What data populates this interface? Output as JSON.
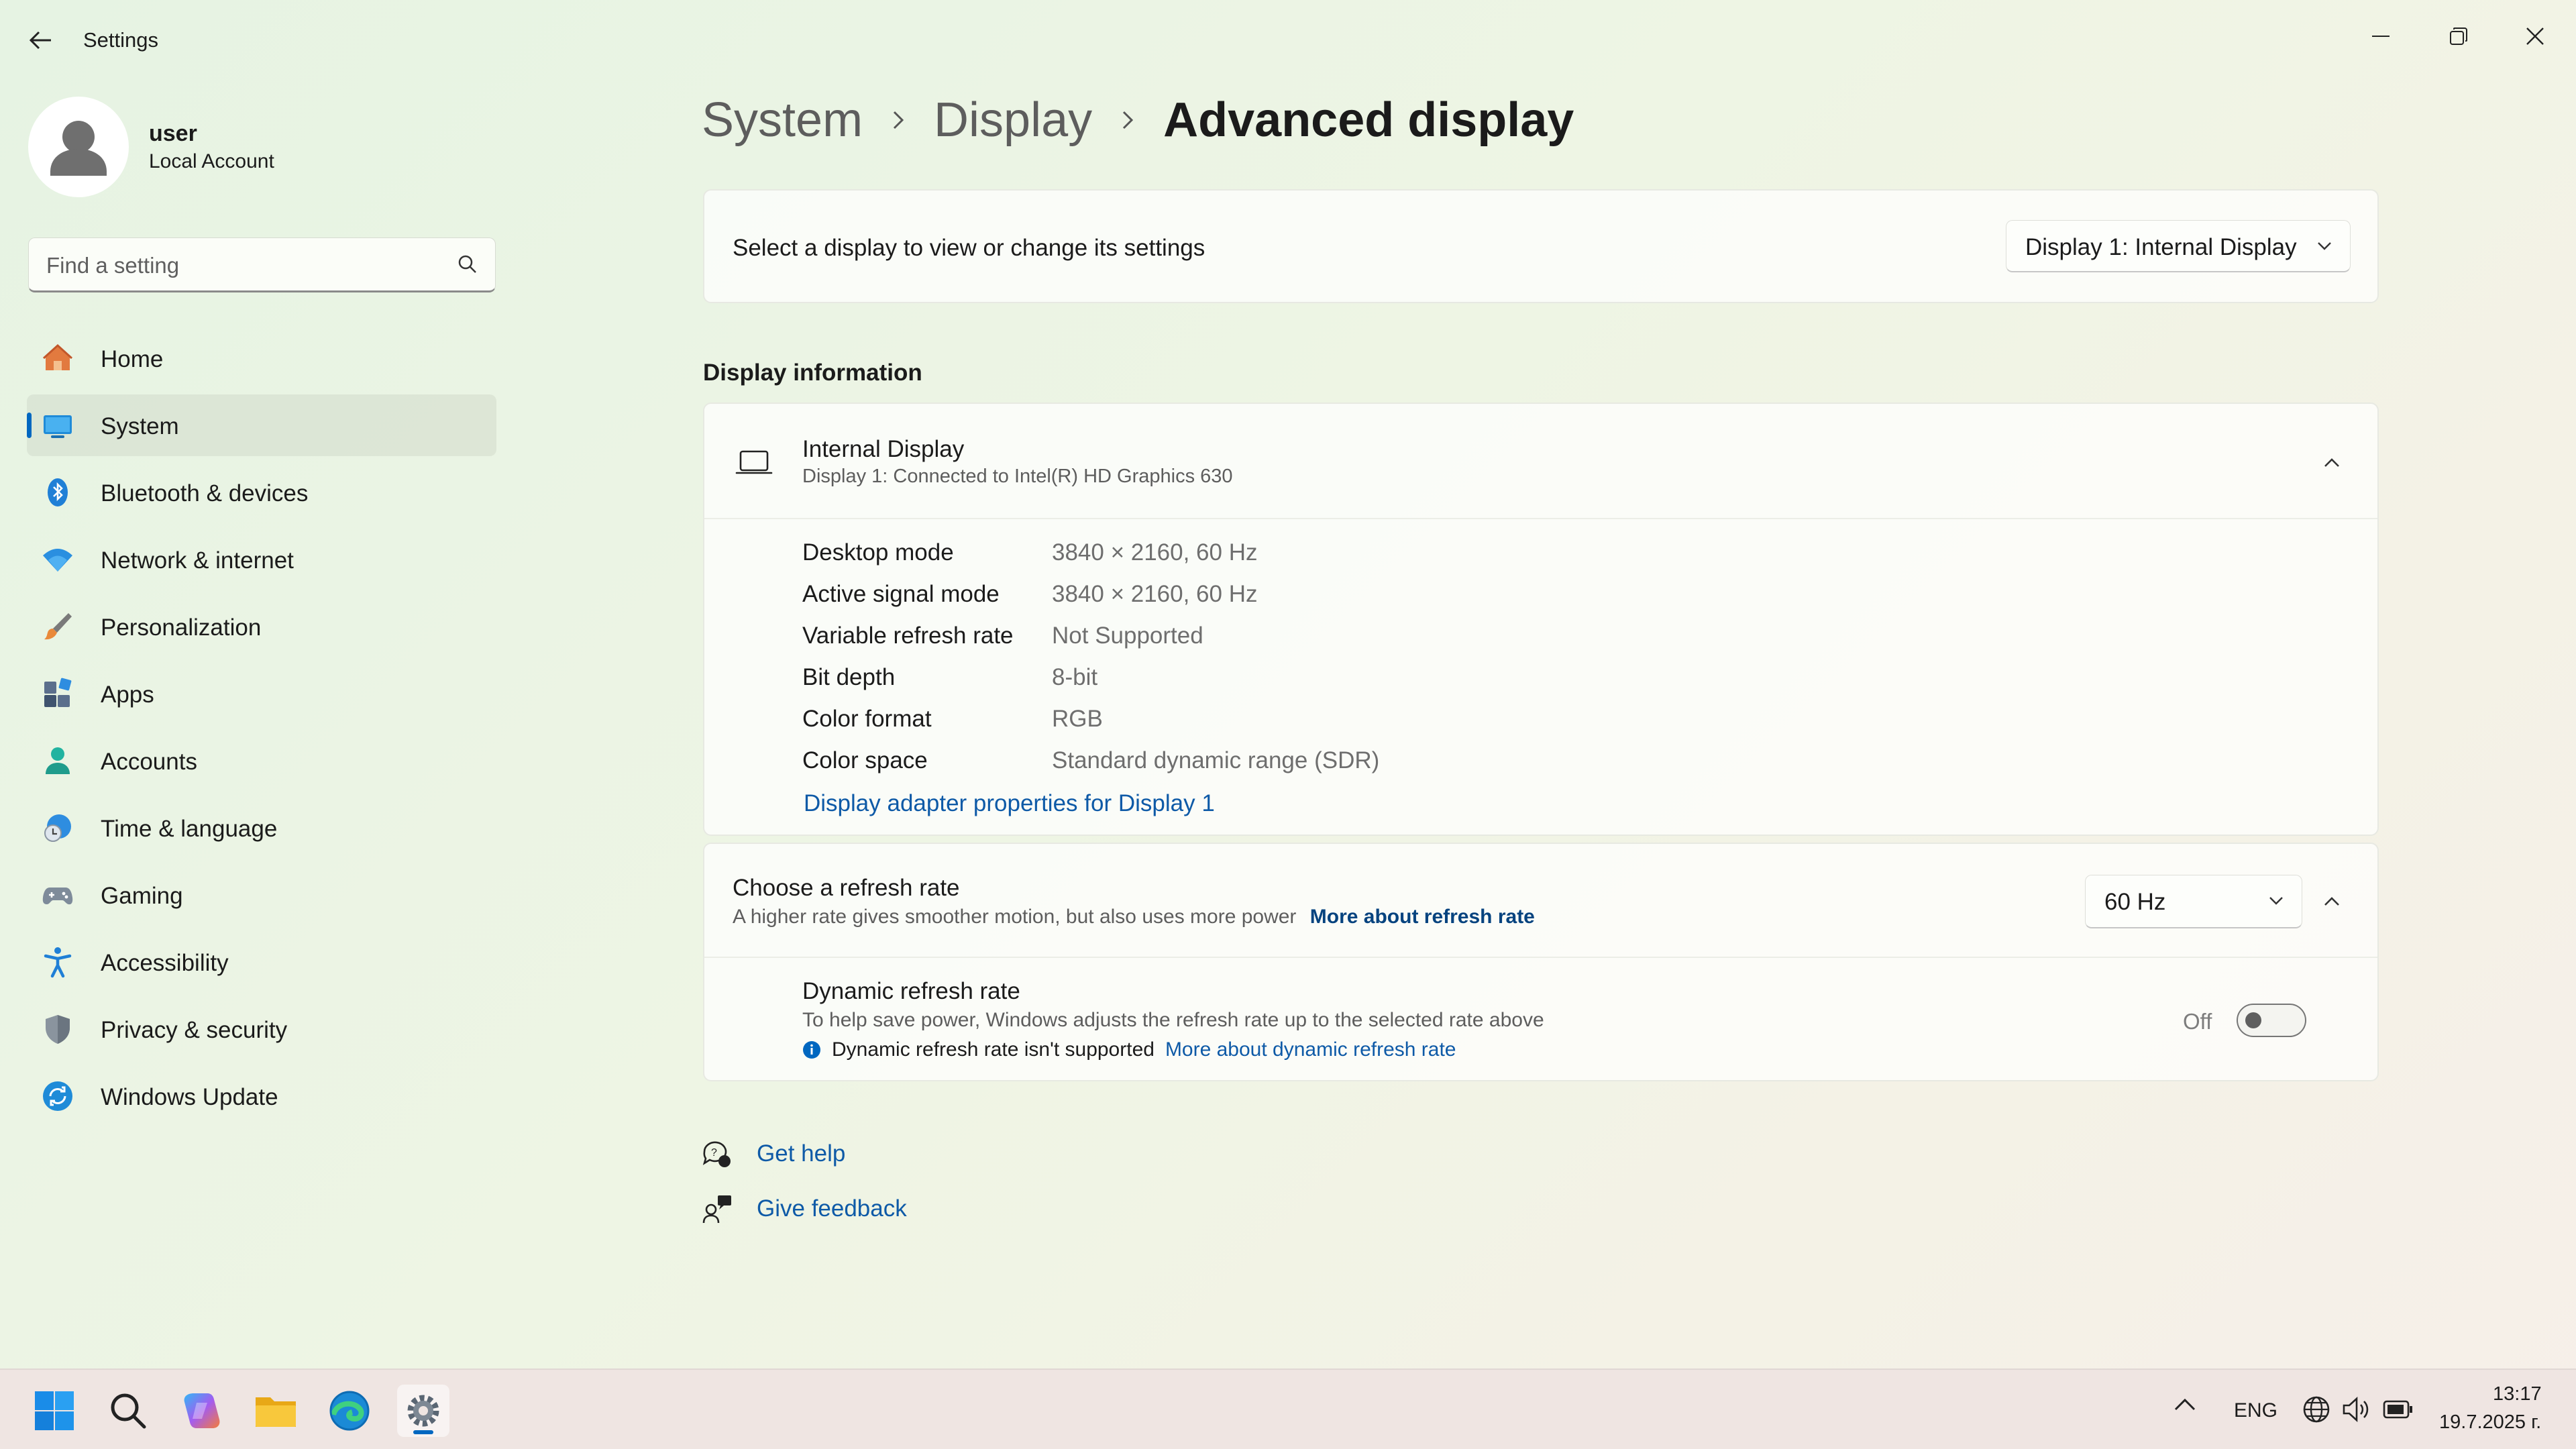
{
  "window": {
    "title": "Settings"
  },
  "profile": {
    "name": "user",
    "account_type": "Local Account"
  },
  "search": {
    "placeholder": "Find a setting"
  },
  "nav": [
    {
      "label": "Home",
      "icon": "home-icon"
    },
    {
      "label": "System",
      "icon": "system-icon",
      "active": true
    },
    {
      "label": "Bluetooth & devices",
      "icon": "bluetooth-icon"
    },
    {
      "label": "Network & internet",
      "icon": "wifi-icon"
    },
    {
      "label": "Personalization",
      "icon": "brush-icon"
    },
    {
      "label": "Apps",
      "icon": "apps-icon"
    },
    {
      "label": "Accounts",
      "icon": "accounts-icon"
    },
    {
      "label": "Time & language",
      "icon": "clock-icon"
    },
    {
      "label": "Gaming",
      "icon": "gamepad-icon"
    },
    {
      "label": "Accessibility",
      "icon": "accessibility-icon"
    },
    {
      "label": "Privacy & security",
      "icon": "shield-icon"
    },
    {
      "label": "Windows Update",
      "icon": "update-icon"
    }
  ],
  "breadcrumb": [
    "System",
    "Display",
    "Advanced display"
  ],
  "display_select": {
    "label": "Select a display to view or change its settings",
    "value": "Display 1: Internal Display"
  },
  "display_info": {
    "section_title": "Display information",
    "title": "Internal Display",
    "subtitle": "Display 1: Connected to Intel(R) HD Graphics 630",
    "rows": [
      {
        "label": "Desktop mode",
        "value": "3840 × 2160, 60 Hz"
      },
      {
        "label": "Active signal mode",
        "value": "3840 × 2160, 60 Hz"
      },
      {
        "label": "Variable refresh rate",
        "value": "Not Supported"
      },
      {
        "label": "Bit depth",
        "value": "8-bit"
      },
      {
        "label": "Color format",
        "value": "RGB"
      },
      {
        "label": "Color space",
        "value": "Standard dynamic range (SDR)"
      }
    ],
    "adapter_link": "Display adapter properties for Display 1"
  },
  "refresh": {
    "title": "Choose a refresh rate",
    "desc": "A higher rate gives smoother motion, but also uses more power",
    "more_link": "More about refresh rate",
    "value": "60 Hz",
    "dynamic": {
      "title": "Dynamic refresh rate",
      "desc": "To help save power, Windows adjusts the refresh rate up to the selected rate above",
      "note": "Dynamic refresh rate isn't supported",
      "more_link": "More about dynamic refresh rate",
      "state_label": "Off",
      "enabled": false
    }
  },
  "help": {
    "get_help": "Get help",
    "feedback": "Give feedback"
  },
  "taskbar": {
    "apps": [
      "start-icon",
      "search-icon",
      "copilot-icon",
      "file-explorer-icon",
      "edge-icon",
      "settings-icon"
    ],
    "language": "ENG",
    "time": "13:17",
    "date": "19.7.2025 г."
  },
  "colors": {
    "accent": "#0067c0",
    "link": "#0e5aa7"
  }
}
